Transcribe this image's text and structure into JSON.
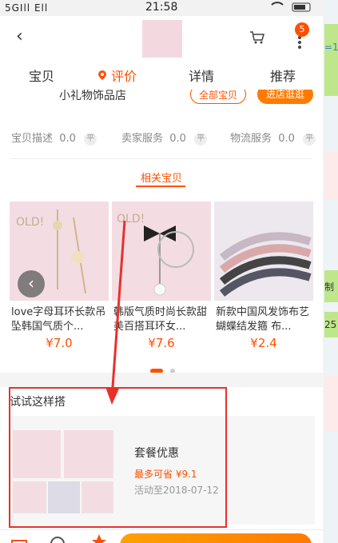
{
  "statusbar": {
    "signal": "5GIll Ell",
    "time": "21:58"
  },
  "header": {
    "cart_badge": "5"
  },
  "tabs": [
    {
      "label": "宝贝",
      "active": false
    },
    {
      "label": "评价",
      "active": true
    },
    {
      "label": "详情",
      "active": false
    },
    {
      "label": "推荐",
      "active": false
    }
  ],
  "shop": {
    "name": "小礼物饰品店",
    "all_items_label": "全部宝贝",
    "enter_shop_label": "进店逛逛"
  },
  "ratings": [
    {
      "label": "宝贝描述",
      "score": "0.0",
      "level": "平"
    },
    {
      "label": "卖家服务",
      "score": "0.0",
      "level": "平"
    },
    {
      "label": "物流服务",
      "score": "0.0",
      "level": "平"
    }
  ],
  "related": {
    "title": "相关宝贝",
    "products": [
      {
        "name": "love字母耳环长款吊坠韩国气质个...",
        "price": "¥7.0"
      },
      {
        "name": "韩版气质时尚长款甜美百搭耳环女...",
        "price": "¥7.6"
      },
      {
        "name": "新款中国风发饰布艺蝴蝶结发箍 布...",
        "price": "¥2.4"
      }
    ]
  },
  "combo": {
    "title": "试试这样搭",
    "deal_title": "套餐优惠",
    "deal_save": "最多可省 ¥9.1",
    "deal_date": "活动至2018-07-12"
  },
  "side": {
    "texts": [
      "=1",
      "制",
      "25"
    ]
  },
  "colors": {
    "accent": "#ff5000",
    "highlight": "#e8312c"
  }
}
